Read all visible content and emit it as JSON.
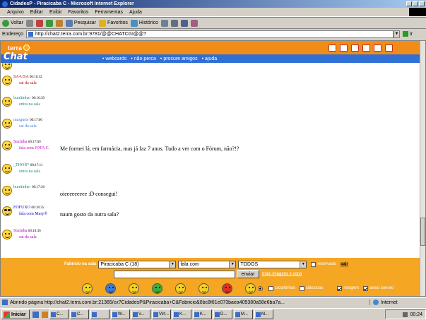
{
  "window": {
    "title": "CidadesP - Piracicaba C - Microsoft Internet Explorer"
  },
  "menu": [
    "Arquivo",
    "Editar",
    "Exibir",
    "Favoritos",
    "Ferramentas",
    "Ajuda"
  ],
  "toolbar": {
    "back": "Voltar",
    "search": "Pesquisar",
    "favorites": "Favoritos",
    "history": "Histórico"
  },
  "address": {
    "label": "Endereço",
    "url": "http://chat2.terra.com.br:9781/@@CHATCGI@@?",
    "go": "Ir"
  },
  "site": {
    "brand": "terra",
    "chat_logo": "Chat",
    "nav": [
      "webcards",
      "não perca",
      "procure amigos",
      "ajuda"
    ]
  },
  "messages": [
    {
      "user": "",
      "time": "",
      "sub": "entra na sala",
      "text": "",
      "user_color": "#b000b0",
      "sub_color": "#1a8a8a"
    },
    {
      "user": "SA-USA",
      "time": "00:16:32",
      "sub": "sai da sala",
      "text": "",
      "user_color": "#c00000",
      "sub_color": "#c00000"
    },
    {
      "user": "bunitinha-",
      "time": "00:16:39",
      "sub": "entra na sala",
      "text": "",
      "user_color": "#1a8a8a",
      "sub_color": "#1a8a8a"
    },
    {
      "user": "margurte",
      "time": "00:17:00",
      "sub": "sai da sala",
      "text": "",
      "user_color": "#4a80c8",
      "sub_color": "#4a80c8"
    },
    {
      "user": "Sozinha",
      "time": "00:17:09",
      "sub": "fala com JOTA C.",
      "text": "Me formei lá, em farmácia, mas já faz 7 anos. Tudo a ver com o Fórum, não?!?",
      "user_color": "#c000c0",
      "sub_color": "#c000c0"
    },
    {
      "user": "_THOR*",
      "time": "00:17:11",
      "sub": "entra na sala",
      "text": "",
      "user_color": "#1a8a8a",
      "sub_color": "#1a8a8a"
    },
    {
      "user": "bunitinha-",
      "time": "00:17:36",
      "sub": "",
      "text": "oieeeeeeeee :D consegui!",
      "user_color": "#1a8a8a",
      "sub_color": "#1a8a8a"
    },
    {
      "user": "FOFUXO",
      "time": "00:18:35",
      "sub": "fala com Mary®",
      "text": "naum gosto da outra sala?",
      "user_color": "#0000c0",
      "sub_color": "#0000c0"
    },
    {
      "user": "Sozinha",
      "time": "00:18:36",
      "sub": "sai da sala",
      "text": "",
      "user_color": "#c000c0",
      "sub_color": "#c000c0"
    }
  ],
  "controls": {
    "room_label": "Fabricio na sala",
    "room": "Piracicaba C (18)",
    "mode": "fala com",
    "target": "TODOS",
    "private_label": "reservado",
    "exit": "sair",
    "message_value": "",
    "send": "enviar",
    "more": "mais imagens e sons",
    "options": [
      "c/cartinhas",
      "clássicas",
      "rolagem",
      "aviso sonoro"
    ]
  },
  "status": {
    "text": "Abrindo página http://chat2.terra.com.br:21365/cx?CidadesP&Piracicaba+C&Fabricio&0bc8f61e073baea405380a58e6ba7a...",
    "zone": "Internet"
  },
  "taskbar": {
    "start": "Iniciar",
    "tasks": [
      "C...",
      "C...",
      "",
      "W...",
      "V...",
      "Virt...",
      "K...",
      "K...",
      "D...",
      "M...",
      "M..."
    ],
    "clock": "00:24"
  },
  "colors": {
    "orange": "#f28c18",
    "blue": "#2f6fd6",
    "controls_bg": "#f5a623"
  },
  "emoticon_colors": [
    "#f5d020",
    "#3a7ad6",
    "#f5d020",
    "#3ab03a",
    "#f5d020",
    "#f5d020",
    "#e03020",
    "#f5d020"
  ]
}
